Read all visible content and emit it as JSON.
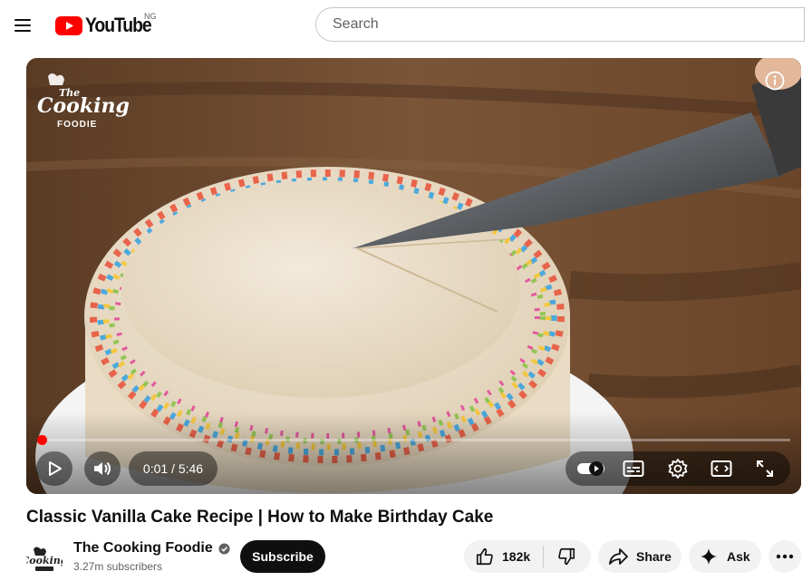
{
  "header": {
    "logo_text": "YouTube",
    "country_code": "NG",
    "search_placeholder": "Search"
  },
  "player": {
    "watermark": {
      "line1": "The",
      "line2": "Cooking",
      "line3": "FOODIE"
    },
    "time_display": "0:01 / 5:46",
    "progress": 0.003,
    "colors": {
      "progress": "#ff0000"
    }
  },
  "video": {
    "title": "Classic Vanilla Cake Recipe | How to Make Birthday Cake"
  },
  "channel": {
    "name": "The Cooking Foodie",
    "subscribers": "3.27m subscribers",
    "subscribe_label": "Subscribe",
    "avatar_text": "Cooking"
  },
  "actions": {
    "like_count": "182k",
    "share_label": "Share",
    "ask_label": "Ask"
  },
  "icons": [
    "menu-icon",
    "youtube-logo-icon",
    "info-icon",
    "play-icon",
    "volume-icon",
    "autoplay-toggle-icon",
    "subtitles-icon",
    "settings-icon",
    "theater-mode-icon",
    "fullscreen-icon",
    "verified-icon",
    "like-icon",
    "dislike-icon",
    "share-icon",
    "sparkle-icon",
    "more-icon"
  ]
}
